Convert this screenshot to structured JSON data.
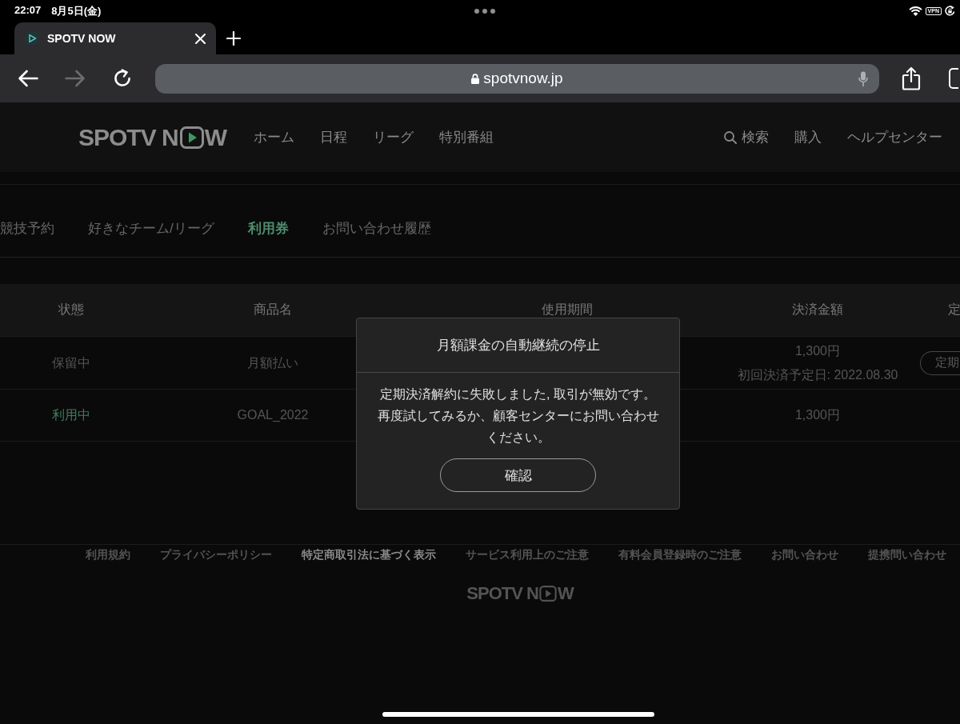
{
  "status_bar": {
    "time": "22:07",
    "date": "8月5日(金)",
    "vpn": "VPN"
  },
  "browser": {
    "tabs": [
      {
        "title": "SPOTV NOW",
        "selected": true
      }
    ],
    "nav_buttons": [
      {
        "kind": "back",
        "disabled": false
      },
      {
        "kind": "forward",
        "disabled": true
      },
      {
        "kind": "reload",
        "disabled": false
      }
    ],
    "address": "spotvnow.jp"
  },
  "header": {
    "logo": {
      "text": "SPOTV N",
      "text_after_icon": "W"
    },
    "nav": [
      "ホーム",
      "日程",
      "リーグ",
      "特別番組"
    ],
    "search": "検索",
    "links": [
      "購入",
      "ヘルプセンター"
    ]
  },
  "subtabs": [
    {
      "label": "競技予約",
      "selected": false
    },
    {
      "label": "好きなチーム/リーグ",
      "selected": false
    },
    {
      "label": "利用券",
      "selected": true
    },
    {
      "label": "お問い合わせ履歴",
      "selected": false
    }
  ],
  "table": {
    "columns": [
      "状態",
      "商品名",
      "使用期間",
      "決済金額",
      "定"
    ],
    "rows": [
      {
        "status": "保留中",
        "active": false,
        "product": "月額払い",
        "amount": "1,300円",
        "note": "初回決済予定日: 2022.08.30",
        "action": "定期"
      },
      {
        "status": "利用中",
        "active": true,
        "product": "GOAL_2022",
        "amount": "1,300円"
      }
    ]
  },
  "dialog": {
    "title": "月額課金の自動継続の停止",
    "message": "定期決済解約に失敗しました, 取引が無効です。再度試してみるか、顧客センターにお問い合わせください。",
    "button": "確認"
  },
  "footer": {
    "links": [
      {
        "label": "利用規約",
        "selected": false
      },
      {
        "label": "プライバシーポリシー",
        "selected": false
      },
      {
        "label": "特定商取引法に基づく表示",
        "selected": true
      },
      {
        "label": "サービス利用上のご注意",
        "selected": false
      },
      {
        "label": "有料会員登録時のご注意",
        "selected": false
      },
      {
        "label": "お問い合わせ",
        "selected": false
      },
      {
        "label": "提携問い合わせ",
        "selected": false
      }
    ],
    "logo": {
      "text": "SPOTV N",
      "text_after_icon": "W"
    }
  }
}
